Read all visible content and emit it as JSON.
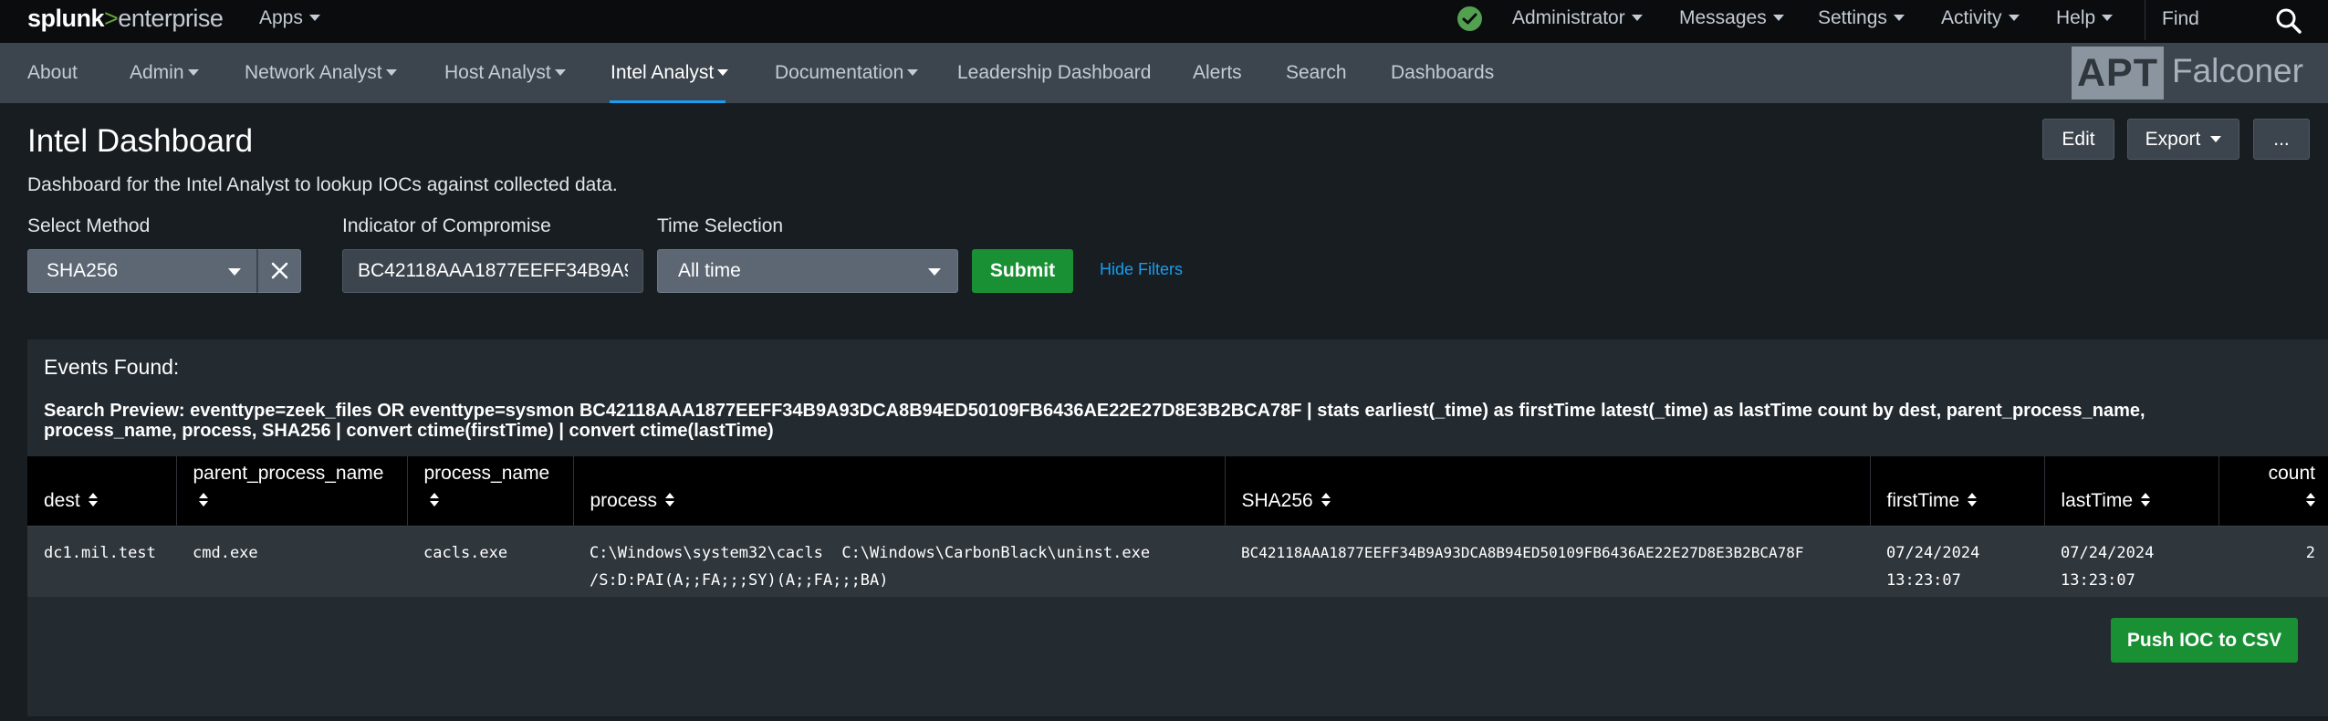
{
  "app": {
    "logo": {
      "part1": "splunk",
      "part2": ">",
      "part3": "enterprise"
    },
    "apps_label": "Apps",
    "status_icon": "check-circle-icon",
    "menus": [
      "Administrator",
      "Messages",
      "Settings",
      "Activity",
      "Help"
    ],
    "find_label": "Find"
  },
  "nav": {
    "items": [
      {
        "label": "About",
        "dropdown": false
      },
      {
        "label": "Admin",
        "dropdown": true
      },
      {
        "label": "Network Analyst",
        "dropdown": true
      },
      {
        "label": "Host Analyst",
        "dropdown": true
      },
      {
        "label": "Intel Analyst",
        "dropdown": true,
        "active": true
      },
      {
        "label": "Documentation",
        "dropdown": true
      },
      {
        "label": "Leadership Dashboard",
        "dropdown": false
      },
      {
        "label": "Alerts",
        "dropdown": false
      },
      {
        "label": "Search",
        "dropdown": false
      },
      {
        "label": "Dashboards",
        "dropdown": false
      }
    ],
    "brand": {
      "apt": "APT",
      "name": "Falconer"
    }
  },
  "dashboard": {
    "title": "Intel Dashboard",
    "description": "Dashboard for the Intel Analyst to lookup IOCs against collected data.",
    "edit_label": "Edit",
    "export_label": "Export",
    "more_label": "..."
  },
  "filters": {
    "method_label": "Select Method",
    "method_value": "SHA256",
    "ioc_label": "Indicator of Compromise",
    "ioc_value": "BC42118AAA1877EEFF34B9A93DCA8B94ED50109FB6436AE22E27D8E3B2BCA78F",
    "time_label": "Time Selection",
    "time_value": "All time",
    "submit_label": "Submit",
    "hide_label": "Hide Filters"
  },
  "panel": {
    "title": "Events Found:",
    "search_preview": "Search Preview: eventtype=zeek_files OR eventtype=sysmon BC42118AAA1877EEFF34B9A93DCA8B94ED50109FB6436AE22E27D8E3B2BCA78F | stats earliest(_time) as firstTime latest(_time) as lastTime count by dest, parent_process_name, process_name, process, SHA256 | convert ctime(firstTime) | convert ctime(lastTime)",
    "columns": [
      "dest",
      "parent_process_name",
      "process_name",
      "process",
      "SHA256",
      "firstTime",
      "lastTime",
      "count"
    ],
    "rows": [
      {
        "dest": "dc1.mil.test",
        "parent_process_name": "cmd.exe",
        "process_name": "cacls.exe",
        "process": "C:\\Windows\\system32\\cacls  C:\\Windows\\CarbonBlack\\uninst.exe /S:D:PAI(A;;FA;;;SY)(A;;FA;;;BA)",
        "SHA256": "BC42118AAA1877EEFF34B9A93DCA8B94ED50109FB6436AE22E27D8E3B2BCA78F",
        "firstTime": "07/24/2024 13:23:07",
        "lastTime": "07/24/2024 13:23:07",
        "count": "2"
      }
    ],
    "push_label": "Push IOC to CSV"
  },
  "colors": {
    "accent": "#1a9cef",
    "submit_green": "#1a9035",
    "status_green": "#53a051",
    "logo_green": "#65a637"
  }
}
